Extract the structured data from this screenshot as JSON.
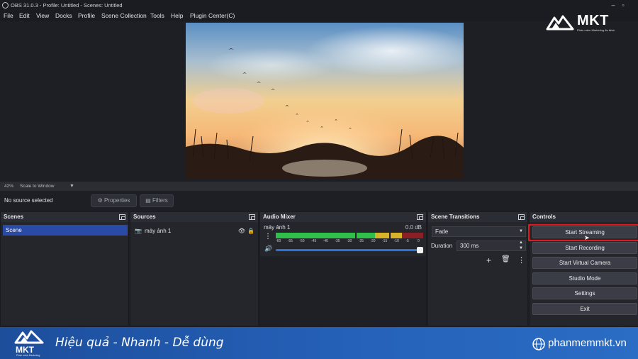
{
  "window": {
    "title": "OBS 31.0.3 - Profile: Untitled - Scenes: Untitled"
  },
  "menu": [
    "File",
    "Edit",
    "View",
    "Docks",
    "Profile",
    "Scene Collection",
    "Tools",
    "Help",
    "Plugin Center(C)"
  ],
  "logo": {
    "brand": "MKT",
    "tagline": "Phần mềm Marketing đa kênh"
  },
  "scale": {
    "zoom": "42%",
    "mode": "Scale to Window"
  },
  "toolbar": {
    "no_source": "No source selected",
    "properties": "Properties",
    "filters": "Filters"
  },
  "docks": {
    "scenes": {
      "title": "Scenes",
      "items": [
        "Scene"
      ]
    },
    "sources": {
      "title": "Sources",
      "items": [
        "máy ảnh 1"
      ]
    },
    "mixer": {
      "title": "Audio Mixer",
      "channel": "máy ảnh 1",
      "level": "0.0 dB",
      "ticks": [
        "-60",
        "-55",
        "-50",
        "-45",
        "-40",
        "-35",
        "-30",
        "-25",
        "-20",
        "-15",
        "-10",
        "-5",
        "0"
      ],
      "volume": 1.0
    },
    "transitions": {
      "title": "Scene Transitions",
      "selected": "Fade",
      "duration_label": "Duration",
      "duration_value": "300 ms"
    },
    "controls": {
      "title": "Controls",
      "buttons": [
        "Start Streaming",
        "Start Recording",
        "Start Virtual Camera",
        "Studio Mode",
        "Settings",
        "Exit"
      ]
    }
  },
  "banner": {
    "slogan": "Hiệu quả - Nhanh  - Dễ dùng",
    "website": "phanmemmkt.vn",
    "brand": "MKT",
    "tagline": "Phần mềm Marketing"
  },
  "colors": {
    "accent_red": "#e11b1b",
    "scene_selected": "#2a4aa8",
    "banner_blue": "#2561b8",
    "meter_green": "#2fbf4a",
    "meter_yellow": "#d8b42a",
    "meter_red": "#8a1f26"
  }
}
